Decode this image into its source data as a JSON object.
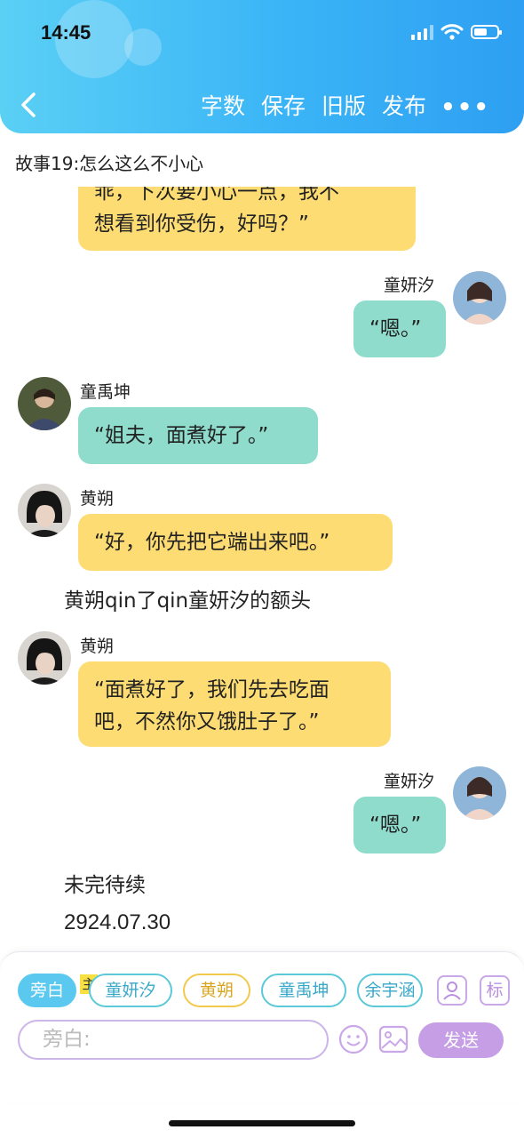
{
  "status": {
    "time": "14:45"
  },
  "toolbar": {
    "word_count": "字数",
    "save": "保存",
    "old_version": "旧版",
    "publish": "发布",
    "more": "•••"
  },
  "story_title": "故事19:怎么这么不小心",
  "messages": [
    {
      "type": "bubble",
      "side": "left",
      "color": "yellow",
      "lines": [
        "乖，下次要小心一点，我不",
        "想看到你受伤，好吗？”"
      ]
    },
    {
      "type": "bubble",
      "side": "right",
      "color": "teal",
      "name": "童妍汐",
      "text": "“嗯。”"
    },
    {
      "type": "bubble",
      "side": "left",
      "color": "teal",
      "name": "童禹坤",
      "text": "“姐夫，面煮好了。”"
    },
    {
      "type": "bubble",
      "side": "left",
      "color": "yellow",
      "name": "黄朔",
      "text": "“好，你先把它端出来吧。”"
    },
    {
      "type": "narration",
      "text": "黄朔qin了qin童妍汐的额头"
    },
    {
      "type": "bubble",
      "side": "left",
      "color": "yellow",
      "name": "黄朔",
      "lines": [
        "“面煮好了，我们先去吃面",
        "吧，不然你又饿肚子了。”"
      ]
    },
    {
      "type": "bubble",
      "side": "right",
      "color": "teal",
      "name": "童妍汐",
      "text": "“嗯。”"
    },
    {
      "type": "narration",
      "text": "未完待续"
    },
    {
      "type": "narration",
      "text": "2924.07.30"
    }
  ],
  "roles": [
    {
      "label": "旁白",
      "style": "active"
    },
    {
      "label": "童妍汐",
      "style": "teal",
      "badge": "主"
    },
    {
      "label": "黄朔",
      "style": "yellow"
    },
    {
      "label": "童禹坤",
      "style": "teal"
    },
    {
      "label": "余宇涵",
      "style": "teal"
    }
  ],
  "icons": {
    "tag_label": "标"
  },
  "input": {
    "placeholder": "旁白:"
  },
  "send_label": "发送",
  "colors": {
    "header": "#3ab4f6",
    "yellow_bubble": "#fddc73",
    "teal_bubble": "#8fdccd",
    "send": "#c59ee6"
  }
}
